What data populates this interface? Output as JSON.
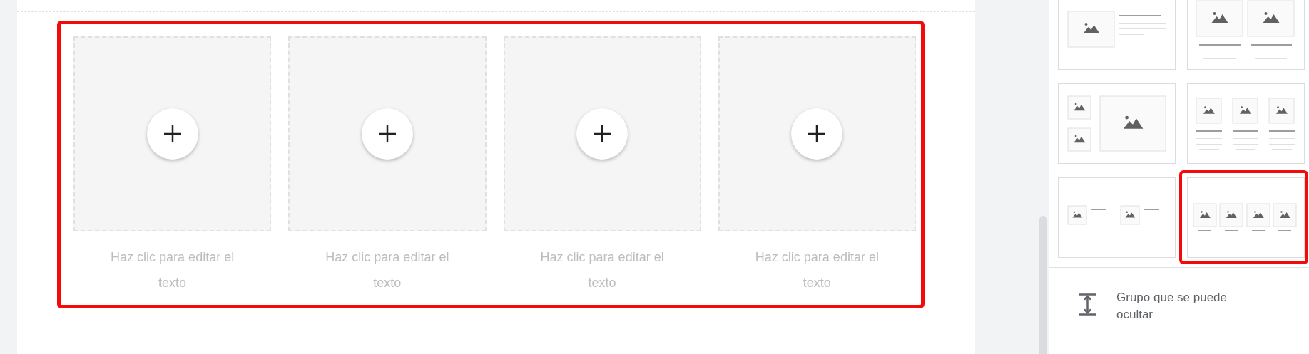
{
  "section": {
    "highlighted": true,
    "items": [
      {
        "caption": "Haz clic para editar el texto"
      },
      {
        "caption": "Haz clic para editar el texto"
      },
      {
        "caption": "Haz clic para editar el texto"
      },
      {
        "caption": "Haz clic para editar el texto"
      }
    ]
  },
  "layouts": [
    {
      "kind": "image-text",
      "selected": false
    },
    {
      "kind": "two-columns",
      "selected": false
    },
    {
      "kind": "gallery",
      "selected": false
    },
    {
      "kind": "three-columns",
      "selected": false
    },
    {
      "kind": "two-image-text",
      "selected": false
    },
    {
      "kind": "four-columns",
      "selected": true
    }
  ],
  "collapsible_group": {
    "label": "Grupo que se puede ocultar"
  }
}
